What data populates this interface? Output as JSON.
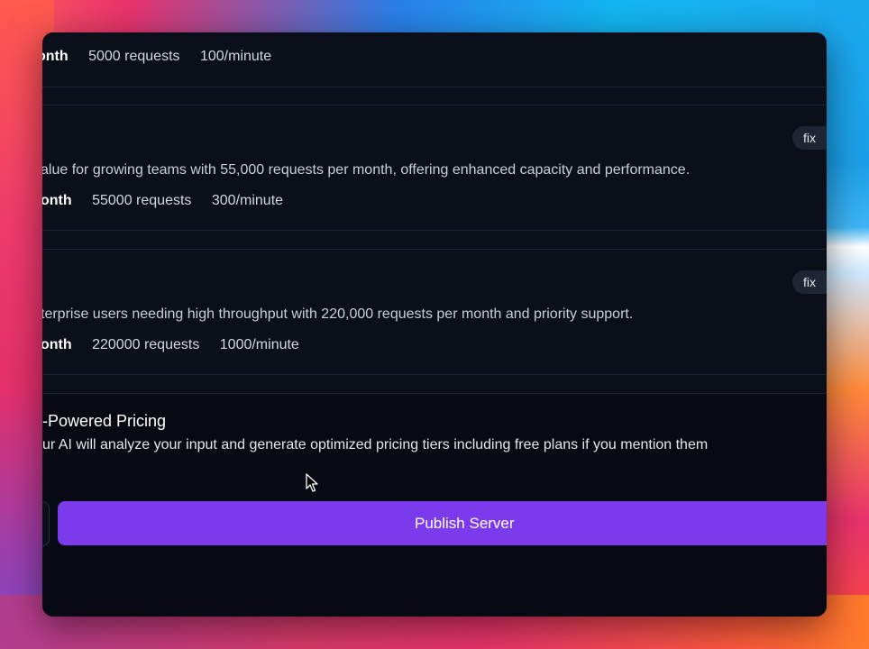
{
  "tiers": [
    {
      "description": "",
      "period": "onth",
      "requests": "5000 requests",
      "rate": "100/minute"
    },
    {
      "badge": "fix",
      "description": "alue for growing teams with 55,000 requests per month, offering enhanced capacity and performance.",
      "period": "onth",
      "requests": "55000 requests",
      "rate": "300/minute"
    },
    {
      "badge": "fix",
      "description": "terprise users needing high throughput with 220,000 requests per month and priority support.",
      "period": "onth",
      "requests": "220000 requests",
      "rate": "1000/minute"
    }
  ],
  "ai_pricing": {
    "title": "-Powered Pricing",
    "description": "ur AI will analyze your input and generate optimized pricing tiers including free plans if you mention them"
  },
  "actions": {
    "publish_label": "Publish Server"
  },
  "colors": {
    "accent": "#7c3aed",
    "window_bg": "#0b0f1a"
  }
}
